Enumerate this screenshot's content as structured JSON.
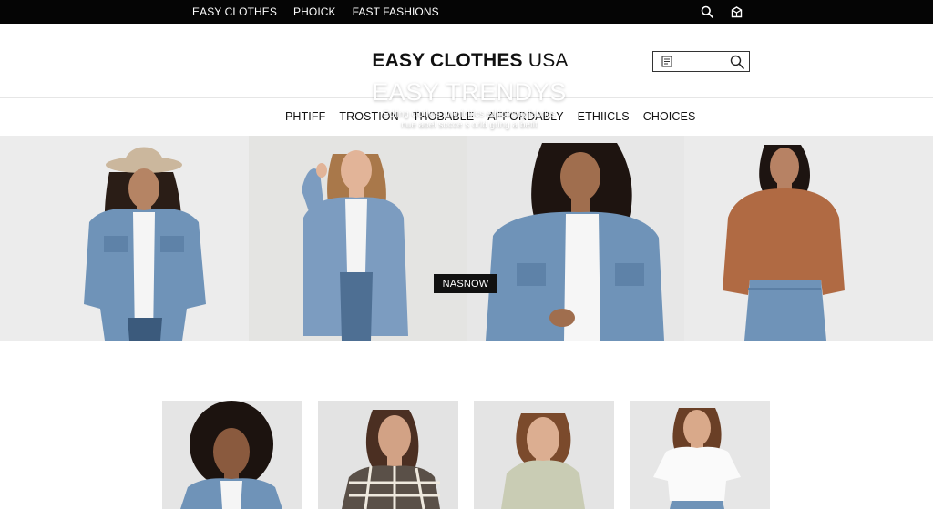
{
  "topbar": {
    "links": [
      "EASY CLOTHES",
      "PHOICK",
      "FAST FASHIONS"
    ],
    "icons": [
      "search-icon",
      "bag-icon"
    ]
  },
  "header": {
    "brand_bold": "EASY CLOTHES",
    "brand_light": "USA",
    "search_placeholder": ""
  },
  "nav": {
    "items": [
      "PHTIFF",
      "TROSTION",
      "THOBABLE",
      "AFFORDABLY",
      "ETHIICLS",
      "CHOICES"
    ]
  },
  "hero": {
    "title": "EASY TRENDYS",
    "subtitle_line1": "Edting clothes une fcbics ethicfrcng fabrics",
    "subtitle_line2": "nue aoel socce s orld gring a betit",
    "button": "NASNOW"
  },
  "colors": {
    "topbar_bg": "#050505",
    "denim": "#6f93b8",
    "sweater": "#b06a43"
  }
}
